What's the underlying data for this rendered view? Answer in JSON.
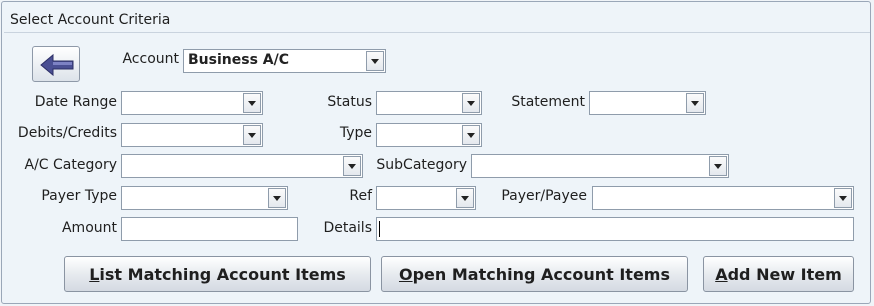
{
  "section": {
    "title": "Select Account Criteria"
  },
  "account": {
    "label": "Account",
    "value": "Business A/C"
  },
  "fields": {
    "date_range": {
      "label": "Date Range",
      "value": ""
    },
    "status": {
      "label": "Status",
      "value": ""
    },
    "statement": {
      "label": "Statement",
      "value": ""
    },
    "debits_credits": {
      "label": "Debits/Credits",
      "value": ""
    },
    "type": {
      "label": "Type",
      "value": ""
    },
    "ac_category": {
      "label": "A/C Category",
      "value": ""
    },
    "subcategory": {
      "label": "SubCategory",
      "value": ""
    },
    "payer_type": {
      "label": "Payer Type",
      "value": ""
    },
    "ref": {
      "label": "Ref",
      "value": ""
    },
    "payer_payee": {
      "label": "Payer/Payee",
      "value": ""
    },
    "amount": {
      "label": "Amount",
      "value": ""
    },
    "details": {
      "label": "Details",
      "value": ""
    }
  },
  "buttons": {
    "list": {
      "accel": "L",
      "rest": "ist Matching Account Items"
    },
    "open": {
      "accel": "O",
      "rest": "pen Matching Account Items"
    },
    "add": {
      "accel": "A",
      "rest": "dd New Item"
    }
  },
  "icons": {
    "back": "arrow-left-icon",
    "dropdown": "chevron-down-icon"
  },
  "colors": {
    "background": "#eef4f9",
    "arrow": "#4a4f93"
  }
}
